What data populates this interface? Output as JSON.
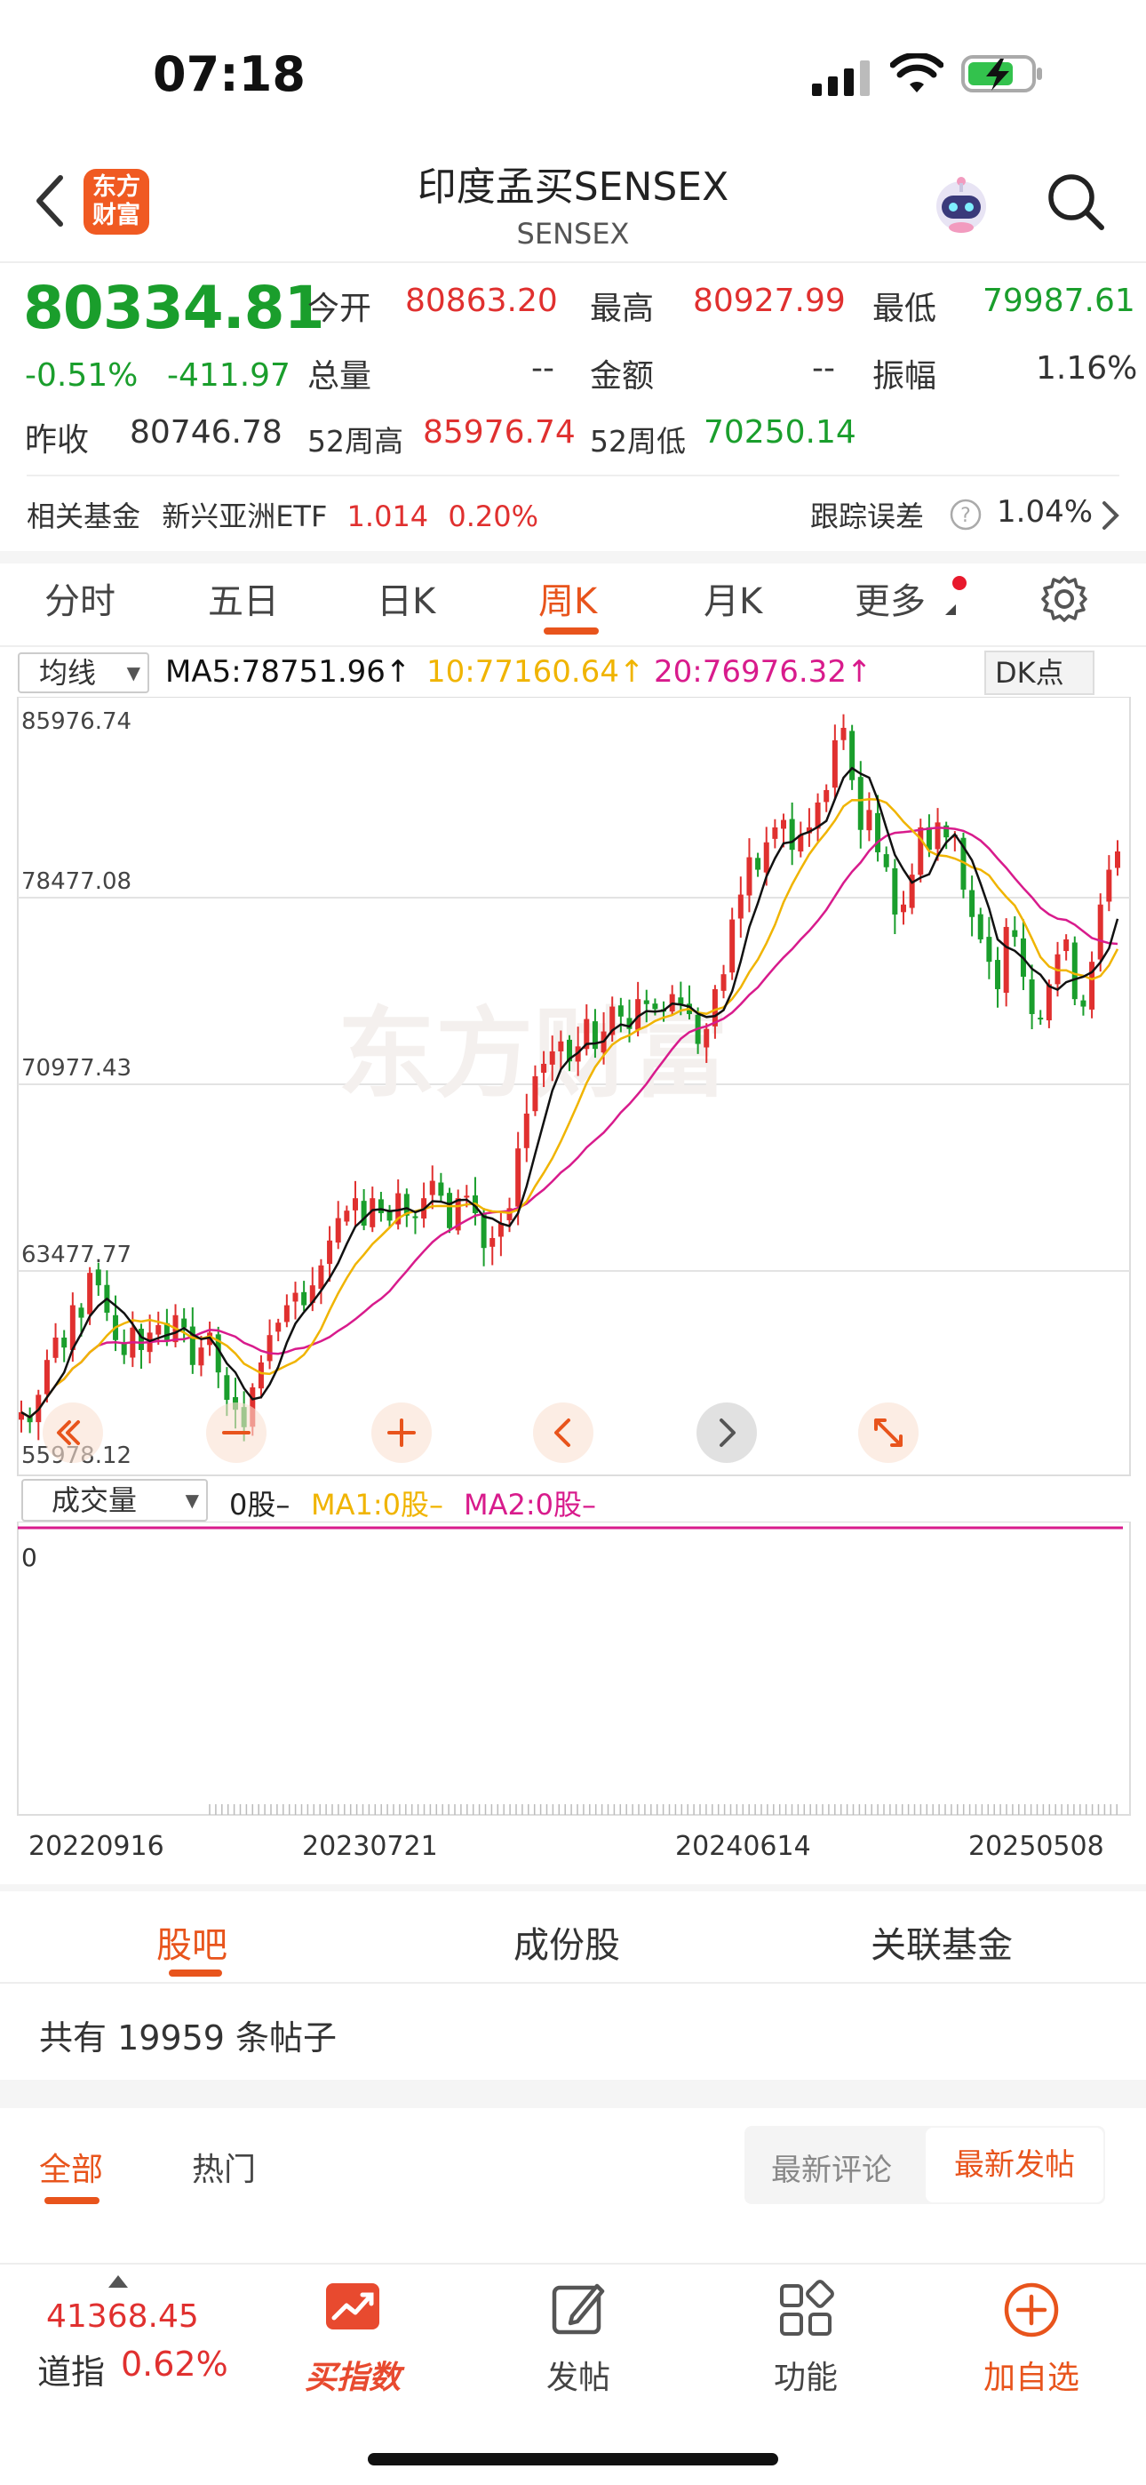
{
  "status": {
    "time": "07:18"
  },
  "header": {
    "logo_text_1": "东方",
    "logo_text_2": "财富",
    "title": "印度孟买SENSEX",
    "subtitle": "SENSEX"
  },
  "quote": {
    "price": "80334.81",
    "change_pct": "-0.51%",
    "change": "-411.97",
    "open_label": "今开",
    "open": "80863.20",
    "high_label": "最高",
    "high": "80927.99",
    "low_label": "最低",
    "low": "79987.61",
    "volume_label": "总量",
    "volume": "--",
    "amount_label": "金额",
    "amount": "--",
    "amplitude_label": "振幅",
    "amplitude": "1.16%",
    "prev_label": "昨收",
    "prev": "80746.78",
    "wk52_high_label": "52周高",
    "wk52_high": "85976.74",
    "wk52_low_label": "52周低",
    "wk52_low": "70250.14"
  },
  "fund": {
    "label": "相关基金",
    "name": "新兴亚洲ETF",
    "price": "1.014",
    "pct": "0.20%",
    "te_label": "跟踪误差",
    "te_value": "1.04%"
  },
  "tabs": [
    "分时",
    "五日",
    "日K",
    "周K",
    "月K",
    "更多"
  ],
  "ma": {
    "select": "均线",
    "ma5": "MA5:78751.96↑",
    "ma10": "10:77160.64↑",
    "ma20": "20:76976.32↑",
    "dk": "DK点"
  },
  "chart_data": {
    "type": "candlestick",
    "y_ticks": [
      "85976.74",
      "78477.08",
      "70977.43",
      "63477.77",
      "55978.12"
    ],
    "ylim": [
      55978.12,
      85976.74
    ],
    "closes": [
      57800,
      57400,
      58500,
      59900,
      60800,
      60400,
      62100,
      61600,
      63400,
      62900,
      61800,
      60700,
      60100,
      61200,
      60300,
      61000,
      61300,
      60700,
      61700,
      61200,
      59700,
      60400,
      61000,
      59400,
      58300,
      57900,
      57200,
      58800,
      59800,
      60900,
      61400,
      62100,
      62600,
      62100,
      62900,
      63700,
      64700,
      65600,
      65900,
      66400,
      65300,
      66400,
      65800,
      65500,
      66600,
      65700,
      65600,
      66400,
      67100,
      66500,
      65200,
      66400,
      66500,
      65800,
      64400,
      64800,
      65400,
      66000,
      68400,
      69800,
      71300,
      71800,
      72300,
      72700,
      71900,
      72500,
      73600,
      72400,
      73100,
      74100,
      73700,
      73200,
      74400,
      74200,
      74000,
      73900,
      74600,
      74200,
      73800,
      72600,
      73200,
      74800,
      75400,
      77600,
      78600,
      80100,
      79600,
      80700,
      81300,
      81600,
      80400,
      81000,
      81300,
      82300,
      82800,
      84800,
      85300,
      83200,
      81200,
      82000,
      80300,
      79700,
      77800,
      78200,
      79400,
      81300,
      80400,
      81500,
      80900,
      81000,
      78800,
      77700,
      76800,
      75900,
      74800,
      77300,
      76900,
      75300,
      73800,
      73600,
      75000,
      76200,
      76800,
      74400,
      74100,
      75900,
      78200,
      79600,
      80334
    ],
    "ma_lines": [
      "MA5",
      "MA10",
      "MA20"
    ]
  },
  "volume": {
    "select": "成交量",
    "vol": "0股–",
    "ma1": "MA1:0股–",
    "ma2": "MA2:0股–",
    "zero": "0"
  },
  "dates": [
    "20220916",
    "20230721",
    "20240614",
    "20250508"
  ],
  "community": {
    "tabs": [
      "股吧",
      "成份股",
      "关联基金"
    ],
    "posts": "共有 19959 条帖子",
    "filters": [
      "全部",
      "热门"
    ],
    "sort": [
      "最新评论",
      "最新发帖"
    ]
  },
  "bottom": {
    "dj_value": "41368.45",
    "dj_label": "道指",
    "dj_pct": "0.62%",
    "items": [
      "买指数",
      "发帖",
      "功能",
      "加自选"
    ]
  },
  "colors": {
    "up": "#e0302f",
    "down": "#1a9e2c",
    "accent": "#e8541c",
    "ma5": "#111111",
    "ma10": "#f0b400",
    "ma20": "#d81b8c"
  }
}
